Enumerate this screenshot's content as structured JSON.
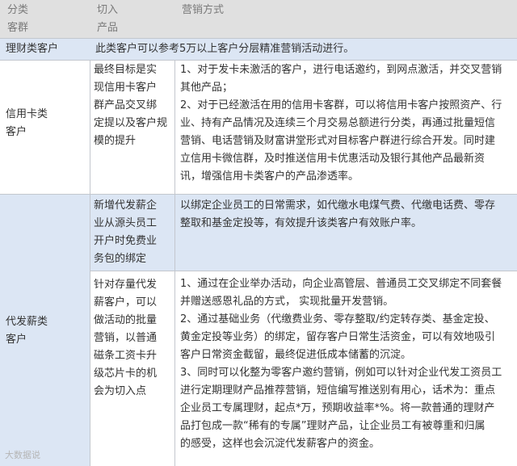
{
  "header": {
    "col1": [
      "分类",
      "客群"
    ],
    "col2": [
      "切入",
      "产品"
    ],
    "col3": "营销方式"
  },
  "rows": {
    "wealth": {
      "category": "理财类客户",
      "method": "此类客户可以参考5万以上客户分层精准营销活动进行。"
    },
    "credit": {
      "category": [
        "信用卡类",
        "客户"
      ],
      "entry": [
        "最终目标是实",
        "现信用卡客户",
        "群产品交叉绑",
        "定提以及客户规",
        "模的提升"
      ],
      "method": [
        "1、对于发卡未激活的客户，进行电话邀约，到网点激活，并交叉营销",
        "其他产品；",
        "2、对于已经激活在用的信用卡客群，可以将信用卡客户按照资产、行",
        "业、持有产品情况及连续三个月交易总额进行分类，再通过批量短信",
        "营销、电话营销及财富讲堂形式对目标客户群进行综合开发。同时建",
        "立信用卡微信群，及时推送信用卡优惠活动及银行其他产品最新资",
        "讯，增强信用卡类客户的产品渗透率。"
      ]
    },
    "payroll": {
      "category": [
        "代发薪类",
        "客户"
      ],
      "entry1": [
        "新增代发薪企",
        "业从源头员工",
        "开户时免费业",
        "务包的绑定"
      ],
      "method1": [
        "以绑定企业员工的日常需求，如代缴水电煤气费、代缴电话费、零存",
        "整取和基金定投等，有效提升该类客户有效账户率。"
      ],
      "entry2": [
        "针对存量代发",
        "薪客户，可以",
        "做活动的批量",
        "营销，以普通",
        "磁条工资卡升",
        "级芯片卡的机",
        "会为切入点"
      ],
      "method2": [
        "1、通过在企业举办活动，向企业高管层、普通员工交叉绑定不同套餐",
        "并赠送感恩礼品的方式，  实现批量开发营销。",
        "2、通过基础业务（代缴费业务、零存整取/约定转存类、基金定投、",
        "黄金定投等业务）的绑定，留存客户日常生活资金，可以有效地吸引",
        "客户日常资金截留，最终促进低成本储蓄的沉淀。",
        "3、同时可以化整为零客户邀约营销，例如可以针对企业代发工资员工",
        "进行定期理财产品推荐营销，短信编写推送别有用心，话术为：重点",
        "企业员工专属理财，起点*万，预期收益率*%。将一款普通的理财产",
        "品打包成一款“稀有的专属”理财产品，让企业员工有被尊重和归属",
        "的感受，这样也会沉淀代发薪客户的资金。"
      ]
    }
  },
  "watermark": "大数据说"
}
